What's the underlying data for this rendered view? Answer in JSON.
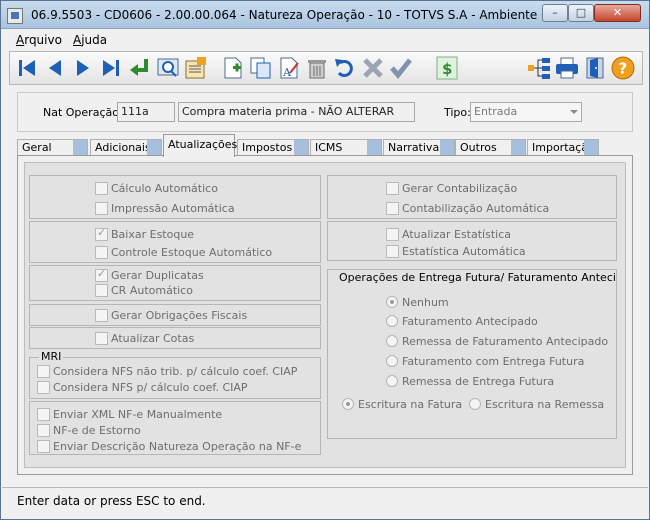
{
  "window": {
    "title": "06.9.5503 - CD0606 - 2.00.00.064 - Natureza Operação - 10 - TOTVS S.A - Ambiente Corporati...",
    "minimize": "–",
    "maximize": "□",
    "close": "✕"
  },
  "menu": {
    "arquivo_first": "A",
    "arquivo_rest": "rquivo",
    "ajuda_first": "A",
    "ajuda_rest": "juda"
  },
  "toolbar": {
    "icons": [
      "first-record",
      "previous-record",
      "next-record",
      "last-record",
      "goto",
      "search",
      "zoom-list",
      "new",
      "copy",
      "rename",
      "delete",
      "undo",
      "cancel",
      "save",
      "currency",
      "structure",
      "print",
      "exit",
      "help"
    ],
    "colors": {
      "nav_blue": "#1f5fb8",
      "green": "#2e8b2e",
      "help_orange": "#f0a020"
    }
  },
  "header": {
    "nat_label": "Nat Operação:",
    "nat_code": "111a",
    "nat_desc": "Compra materia prima - NÃO ALTERAR",
    "tipo_label": "Tipo:",
    "tipo_value": "Entrada"
  },
  "tabs": [
    "Geral",
    "Adicionais",
    "Atualizações",
    "Impostos",
    "ICMS",
    "Narrativa",
    "Outros",
    "Importação"
  ],
  "active_tab": "Atualizações",
  "left": {
    "calculo_auto": {
      "label": "Cálculo Automático",
      "checked": false
    },
    "impressao_auto": {
      "label": "Impressão Automática",
      "checked": false
    },
    "baixar_estoque": {
      "label": "Baixar Estoque",
      "checked": true
    },
    "controle_estoque": {
      "label": "Controle Estoque Automático",
      "checked": false
    },
    "gerar_duplicatas": {
      "label": "Gerar Duplicatas",
      "checked": true
    },
    "cr_auto": {
      "label": "CR Automático",
      "checked": false
    },
    "gerar_obrigacoes": {
      "label": "Gerar Obrigações Fiscais",
      "checked": false
    },
    "atualizar_cotas": {
      "label": "Atualizar Cotas",
      "checked": false
    },
    "mri_title": "MRI",
    "nfs_nao_trib": {
      "label": "Considera NFS não trib. p/ cálculo coef. CIAP",
      "checked": false
    },
    "nfs_calc": {
      "label": "Considera NFS p/ cálculo coef. CIAP",
      "checked": false
    },
    "enviar_xml": {
      "label": "Enviar XML NF-e Manualmente",
      "checked": false
    },
    "nfe_estorno": {
      "label": "NF-e de Estorno",
      "checked": false
    },
    "enviar_descricao": {
      "label": "Enviar Descrição Natureza Operação na NF-e",
      "checked": false
    }
  },
  "right": {
    "gerar_contab": {
      "label": "Gerar Contabilização",
      "checked": false
    },
    "contab_auto": {
      "label": "Contabilização Automática",
      "checked": false
    },
    "atualizar_estat": {
      "label": "Atualizar Estatística",
      "checked": false
    },
    "estat_auto": {
      "label": "Estatística Automática",
      "checked": false
    },
    "entrega_title": "Operações de Entrega Futura/ Faturamento Antecipado",
    "radio_nenhum": "Nenhum",
    "radio_fat_antecipado": "Faturamento Antecipado",
    "radio_remessa_fat": "Remessa de Faturamento Antecipado",
    "radio_fat_entrega": "Faturamento com Entrega Futura",
    "radio_remessa_entrega": "Remessa de Entrega Futura",
    "radio_escritura_fatura": "Escritura na Fatura",
    "radio_escritura_remessa": "Escritura na Remessa",
    "selected_operation": "Nenhum",
    "selected_escritura": "Escritura na Fatura"
  },
  "status": "Enter data or press ESC to end."
}
